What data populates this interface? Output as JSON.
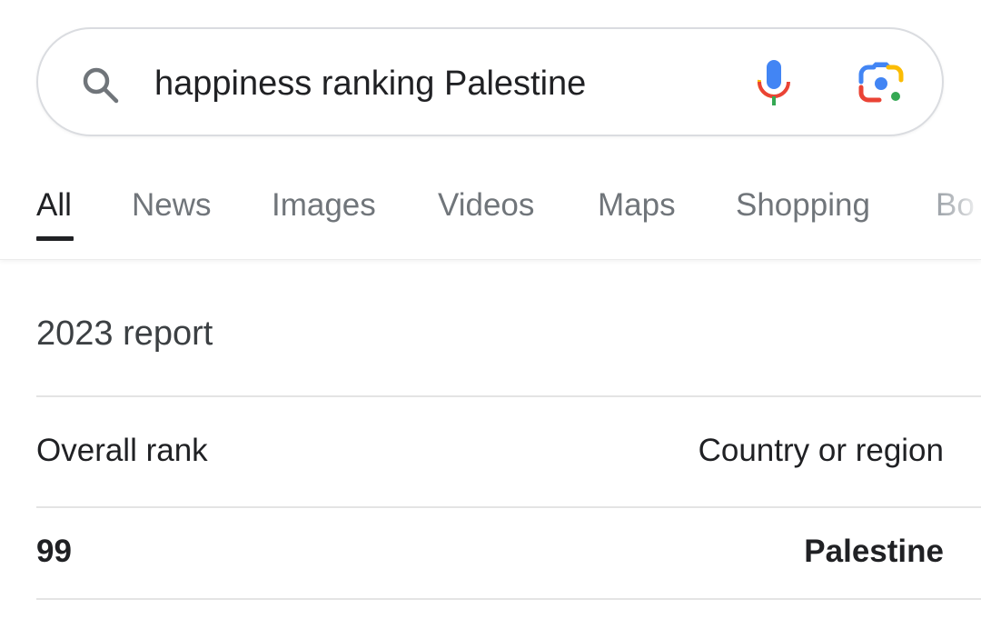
{
  "search": {
    "query": "happiness ranking Palestine",
    "icons": {
      "left": "search-icon",
      "voice": "microphone-icon",
      "lens": "google-lens-icon"
    }
  },
  "tabs": [
    {
      "label": "All",
      "active": true
    },
    {
      "label": "News",
      "active": false
    },
    {
      "label": "Images",
      "active": false
    },
    {
      "label": "Videos",
      "active": false
    },
    {
      "label": "Maps",
      "active": false
    },
    {
      "label": "Shopping",
      "active": false
    },
    {
      "label": "Bo",
      "active": false
    }
  ],
  "report": {
    "title": "2023 report",
    "columns": [
      "Overall rank",
      "Country or region"
    ],
    "rows": [
      {
        "rank": "99",
        "country": "Palestine"
      }
    ]
  },
  "colors": {
    "google_blue": "#4285f4",
    "google_red": "#ea4335",
    "google_yellow": "#fbbc04",
    "google_green": "#34a853"
  }
}
